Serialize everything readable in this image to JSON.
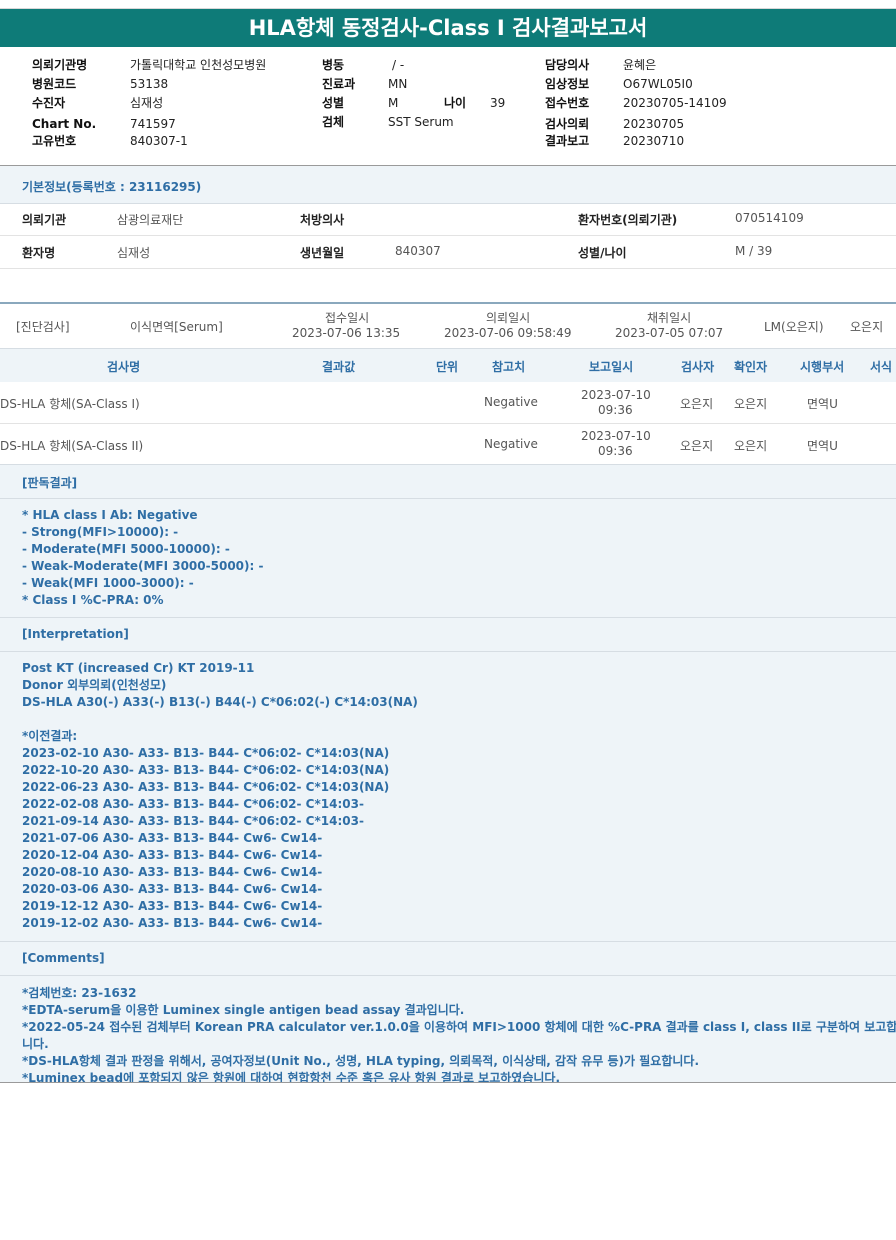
{
  "title": "HLA항체 동정검사-Class I 검사결과보고서",
  "header": {
    "col1": [
      {
        "label": "의뢰기관명",
        "value": "가톨릭대학교 인천성모병원"
      },
      {
        "label": "병원코드",
        "value": "53138"
      },
      {
        "label": "수진자",
        "value": "심재성"
      },
      {
        "label": "Chart No.",
        "value": "741597"
      },
      {
        "label": "고유번호",
        "value": "840307-1"
      }
    ],
    "col2": [
      {
        "label": "병동",
        "value": "/ -"
      },
      {
        "label": "진료과",
        "value": "MN"
      },
      {
        "label": "성별",
        "value": "M"
      },
      {
        "label": "검체",
        "value": "SST Serum"
      }
    ],
    "age_label": "나이",
    "age_value": "39",
    "col3": [
      {
        "label": "담당의사",
        "value": "윤혜은"
      },
      {
        "label": "임상정보",
        "value": "O67WL05I0"
      },
      {
        "label": "접수번호",
        "value": "20230705-14109"
      },
      {
        "label": "검사의뢰",
        "value": "20230705"
      },
      {
        "label": "결과보고",
        "value": "20230710"
      }
    ]
  },
  "basic": {
    "title": "기본정보(등록번호 : 23116295)",
    "row1": {
      "l1": "의뢰기관",
      "v1": "삼광의료재단",
      "l2": "처방의사",
      "v2": "",
      "l3": "환자번호(의뢰기관)",
      "v3": "070514109"
    },
    "row2": {
      "l1": "환자명",
      "v1": "심재성",
      "l2": "생년월일",
      "v2": "840307",
      "l3": "성별/나이",
      "v3": "M / 39"
    }
  },
  "exam": {
    "category": "[진단검사]",
    "type": "이식면역[Serum]",
    "recv_label": "접수일시",
    "recv_value": "2023-07-06 13:35",
    "req_label": "의뢰일시",
    "req_value": "2023-07-06 09:58:49",
    "coll_label": "채취일시",
    "coll_value": "2023-07-05 07:07",
    "lm": "LM(오은지)",
    "person": "오은지"
  },
  "table": {
    "headers": [
      "검사명",
      "결과값",
      "단위",
      "참고치",
      "보고일시",
      "검사자",
      "확인자",
      "시행부서",
      "서식"
    ],
    "rows": [
      {
        "name": "DS-HLA 항체(SA-Class I)",
        "ref": "Negative",
        "date": "2023-07-10",
        "time": "09:36",
        "tester": "오은지",
        "checker": "오은지",
        "dept": "면역U"
      },
      {
        "name": "DS-HLA 항체(SA-Class II)",
        "ref": "Negative",
        "date": "2023-07-10",
        "time": "09:36",
        "tester": "오은지",
        "checker": "오은지",
        "dept": "면역U"
      }
    ]
  },
  "judgement": {
    "title": "[판독결과]",
    "lines": [
      "* HLA class I Ab: Negative",
      "- Strong(MFI>10000): -",
      "- Moderate(MFI 5000-10000): -",
      "- Weak-Moderate(MFI 3000-5000): -",
      "- Weak(MFI 1000-3000): -",
      "* Class I %C-PRA: 0%"
    ]
  },
  "interpretation": {
    "title": "[Interpretation]",
    "lines": [
      "Post KT (increased Cr) KT 2019-11",
      "Donor 외부의뢰(인천성모)",
      "DS-HLA A30(-) A33(-) B13(-) B44(-) C*06:02(-) C*14:03(NA)",
      "",
      "*이전결과:",
      "2023-02-10 A30- A33- B13- B44- C*06:02- C*14:03(NA)",
      "2022-10-20 A30- A33- B13- B44- C*06:02- C*14:03(NA)",
      "2022-06-23 A30- A33- B13- B44- C*06:02- C*14:03(NA)",
      "2022-02-08 A30- A33- B13- B44- C*06:02- C*14:03-",
      "2021-09-14 A30- A33- B13- B44- C*06:02- C*14:03-",
      "2021-07-06 A30- A33- B13- B44- Cw6- Cw14-",
      "2020-12-04 A30- A33- B13- B44- Cw6- Cw14-",
      "2020-08-10 A30- A33- B13- B44- Cw6- Cw14-",
      "2020-03-06 A30- A33- B13- B44- Cw6- Cw14-",
      "2019-12-12 A30- A33- B13- B44- Cw6- Cw14-",
      "2019-12-02 A30- A33- B13- B44- Cw6- Cw14-"
    ]
  },
  "comments": {
    "title": "[Comments]",
    "lines": [
      "*검체번호: 23-1632",
      "*EDTA-serum을 이용한 Luminex single antigen bead assay 결과입니다.",
      "*2022-05-24 접수된 검체부터 Korean PRA calculator ver.1.0.0을 이용하여 MFI>1000 항체에 대한 %C-PRA 결과를 class I, class II로 구분하여 보고합",
      "니다.",
      "*DS-HLA항체 결과 판정을 위해서, 공여자정보(Unit No., 성명, HLA typing, 의뢰목적, 이식상태, 감작 유무 등)가 필요합니다.",
      "*Luminex bead에 포함되지 않은 항원에 대하여 현합항천 수준 혹은 유사 항원 결과로 보고하였습니다."
    ]
  }
}
